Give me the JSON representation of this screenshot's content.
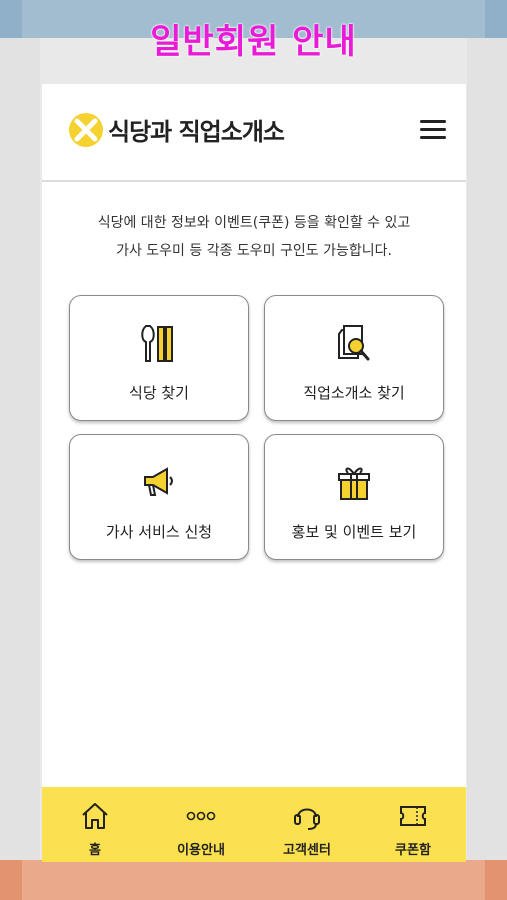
{
  "banner": {
    "title": "일반회원 안내"
  },
  "app": {
    "brand_name": "식당과 직업소개소"
  },
  "intro": {
    "line1": "식당에 대한 정보와 이벤트(쿠폰) 등을 확인할 수 있고",
    "line2": "가사 도우미 등 각종 도우미 구인도 가능합니다."
  },
  "cards": [
    {
      "label": "식당 찾기",
      "icon": "utensils-icon"
    },
    {
      "label": "직업소개소 찾기",
      "icon": "document-search-icon"
    },
    {
      "label": "가사 서비스 신청",
      "icon": "megaphone-icon"
    },
    {
      "label": "홍보 및 이벤트 보기",
      "icon": "gift-icon"
    }
  ],
  "tabbar": {
    "items": [
      {
        "label": "홈",
        "icon": "home-icon"
      },
      {
        "label": "이용안내",
        "icon": "more-dots-icon"
      },
      {
        "label": "고객센터",
        "icon": "headset-icon"
      },
      {
        "label": "쿠폰함",
        "icon": "ticket-icon"
      }
    ]
  },
  "colors": {
    "accent": "#fbe04f",
    "banner_title": "#ea1bd6",
    "top_bg": "#a3bdd0",
    "bottom_bg": "#eaa98a"
  }
}
